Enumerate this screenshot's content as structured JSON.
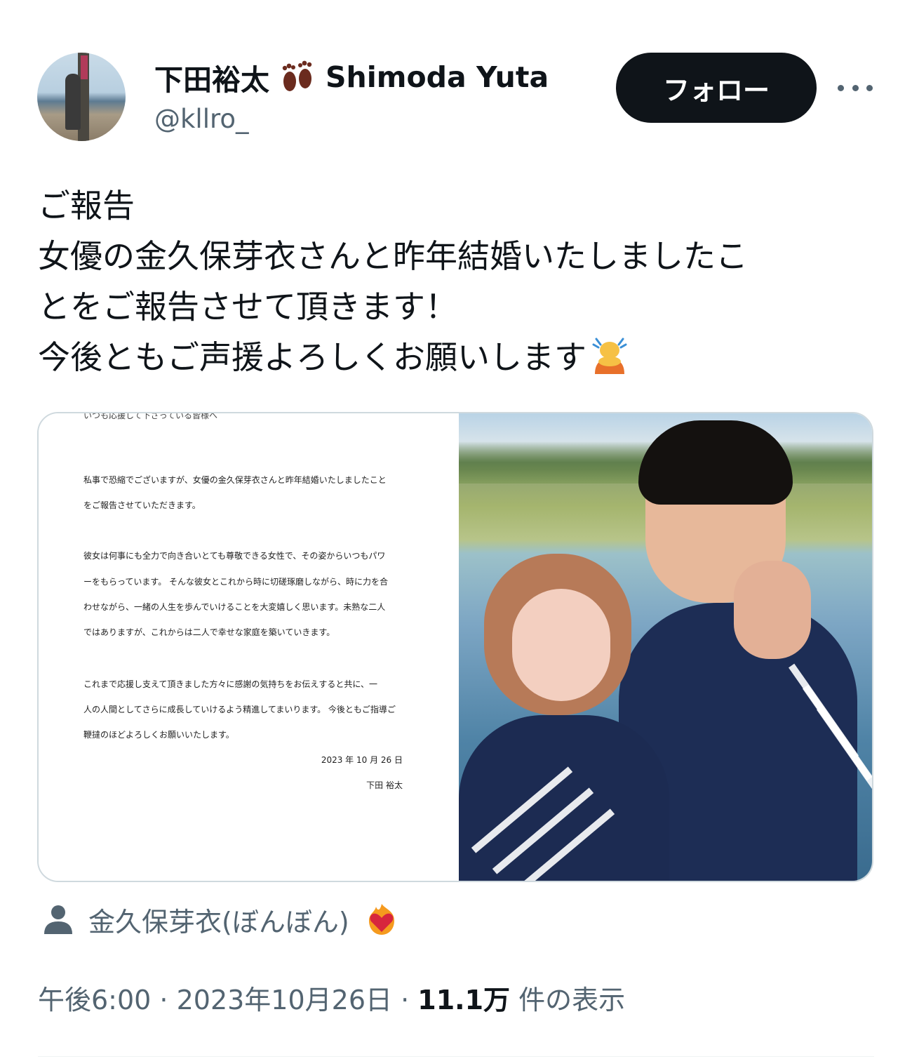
{
  "author": {
    "display_name": "下田裕太",
    "display_name_latin": "Shimoda Yuta",
    "handle": "@kllro_",
    "name_emoji_icon": "footprints-icon"
  },
  "actions": {
    "follow_label": "フォロー",
    "more_icon": "more-horizontal-icon"
  },
  "tweet": {
    "lines": [
      "ご報告",
      "女優の金久保芽衣さんと昨年結婚いたしましたこ",
      "とをご報告させて頂きます！",
      "今後ともご声援よろしくお願いします"
    ],
    "trailing_emoji_icon": "person-bowing-icon"
  },
  "media": {
    "letter": {
      "cut_line": "いつも応援して下さっている皆様へ",
      "paragraphs": [
        "私事で恐縮でございますが、女優の金久保芽衣さんと昨年結婚いたしましたこと",
        "をご報告させていただきます。",
        "彼女は何事にも全力で向き合いとても尊敬できる女性で、その姿からいつもパワ",
        "ーをもらっています。 そんな彼女とこれから時に切磋琢磨しながら、時に力を合",
        "わせながら、一緒の人生を歩んでいけることを大変嬉しく思います。未熟な二人",
        "ではありますが、これからは二人で幸せな家庭を築いていきます。",
        "これまで応援し支えて頂きました方々に感謝の気持ちをお伝えすると共に、一",
        "人の人間としてさらに成長していけるよう精進してまいります。 今後ともご指導ご",
        "鞭撻のほどよろしくお願いいたします。"
      ],
      "date": "2023 年 10 月 26 日",
      "signature": "下田 裕太"
    }
  },
  "tagged": {
    "name": "金久保芽衣(ぼんぼん)",
    "icon": "person-icon",
    "trailing_emoji_icon": "heart-on-fire-icon"
  },
  "meta": {
    "time": "午後6:00",
    "separator": " · ",
    "date": "2023年10月26日",
    "views_count": "11.1万",
    "views_label": " 件の表示"
  },
  "colors": {
    "text_primary": "#0f1419",
    "text_secondary": "#536471",
    "follow_bg": "#0f1419",
    "border": "#cfd9de"
  }
}
